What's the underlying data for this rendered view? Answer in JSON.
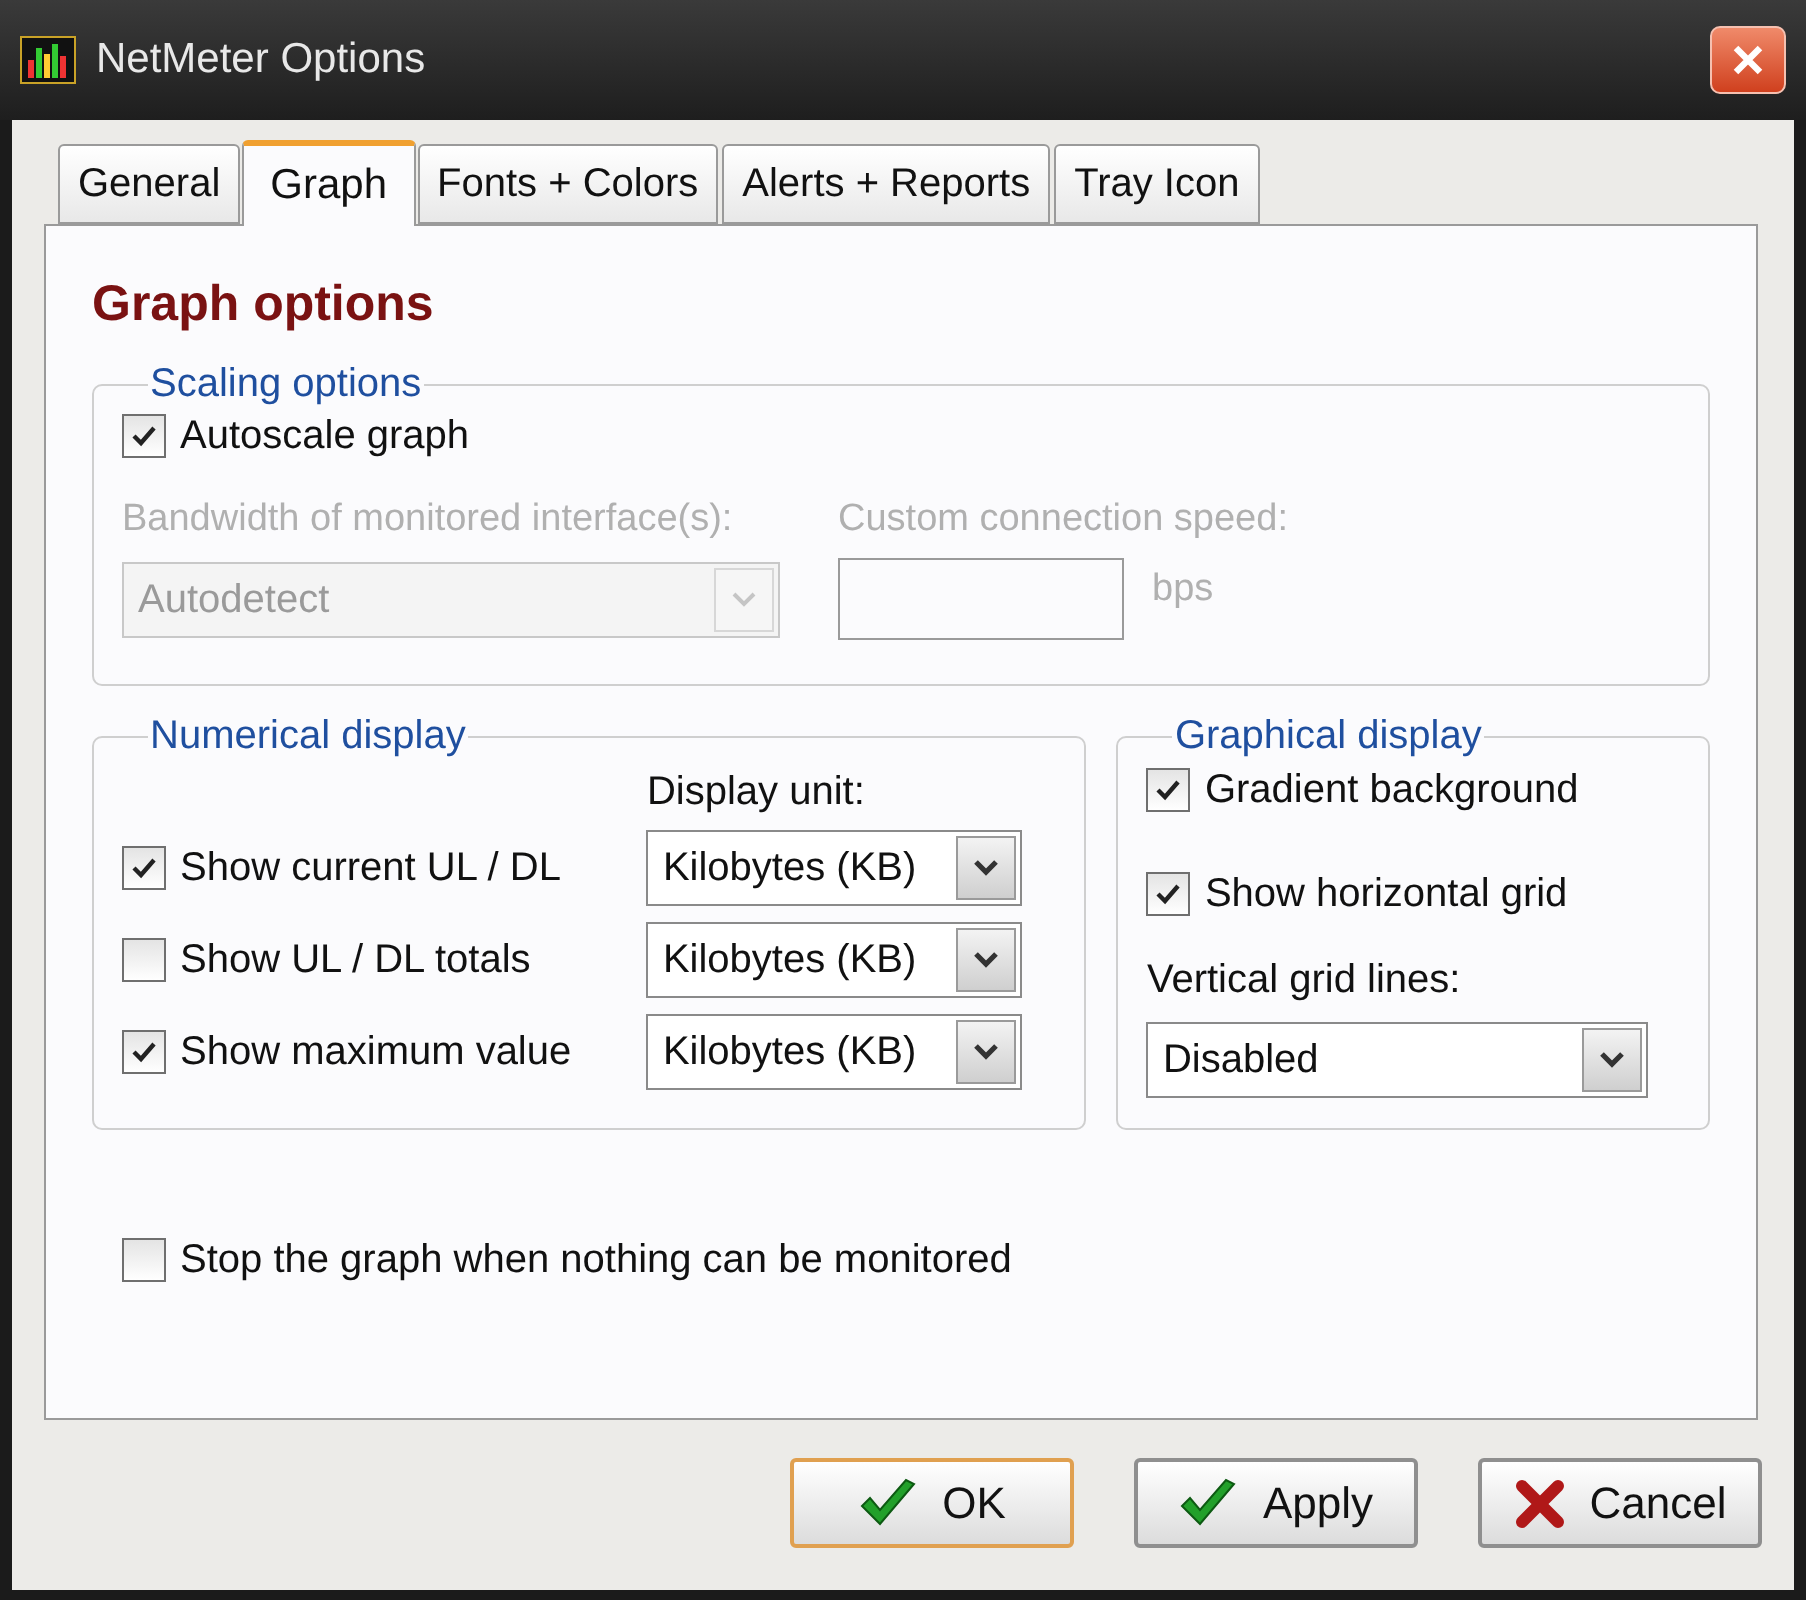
{
  "window": {
    "title": "NetMeter Options"
  },
  "tabs": [
    {
      "label": "General",
      "selected": false
    },
    {
      "label": "Graph",
      "selected": true
    },
    {
      "label": "Fonts + Colors",
      "selected": false
    },
    {
      "label": "Alerts + Reports",
      "selected": false
    },
    {
      "label": "Tray Icon",
      "selected": false
    }
  ],
  "heading": "Graph options",
  "scaling": {
    "legend": "Scaling options",
    "autoscale": {
      "label": "Autoscale graph",
      "checked": true
    },
    "bandwidth": {
      "label": "Bandwidth of monitored interface(s):",
      "value": "Autodetect",
      "disabled": true
    },
    "custom_speed": {
      "label": "Custom connection speed:",
      "unit": "bps",
      "disabled": true
    }
  },
  "numerical": {
    "legend": "Numerical display",
    "unit_header": "Display unit:",
    "rows": [
      {
        "label": "Show current UL / DL",
        "checked": true,
        "unit": "Kilobytes (KB)"
      },
      {
        "label": "Show UL / DL totals",
        "checked": false,
        "unit": "Kilobytes (KB)"
      },
      {
        "label": "Show maximum value",
        "checked": true,
        "unit": "Kilobytes (KB)"
      }
    ]
  },
  "graphical": {
    "legend": "Graphical display",
    "options": [
      {
        "label": "Gradient background",
        "checked": true
      },
      {
        "label": "Show horizontal grid",
        "checked": true
      }
    ],
    "vertical_label": "Vertical grid lines:",
    "vertical_value": "Disabled"
  },
  "stop_graph": {
    "label": "Stop the graph when nothing can be monitored",
    "checked": false
  },
  "buttons": [
    {
      "label": "OK",
      "kind": "ok",
      "focused": true
    },
    {
      "label": "Apply",
      "kind": "apply",
      "focused": false
    },
    {
      "label": "Cancel",
      "kind": "cancel",
      "focused": false
    }
  ]
}
